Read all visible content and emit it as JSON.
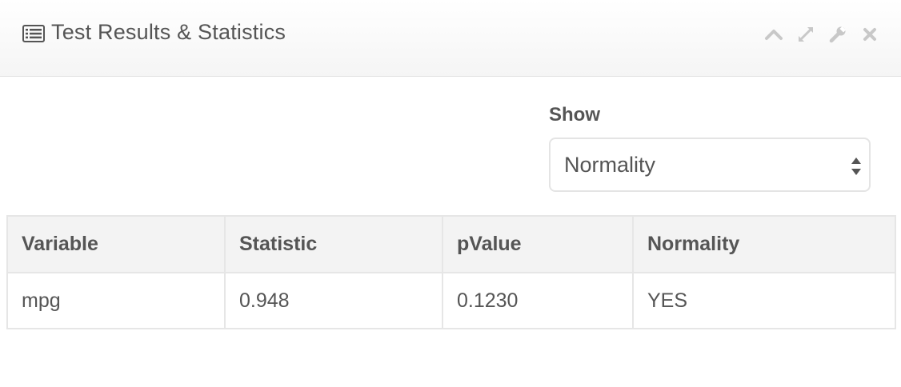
{
  "header": {
    "title": "Test Results & Statistics",
    "title_icon": "list-alt-icon",
    "tools": [
      {
        "name": "collapse-icon"
      },
      {
        "name": "fullscreen-icon"
      },
      {
        "name": "wrench-icon"
      },
      {
        "name": "close-icon"
      }
    ]
  },
  "filter": {
    "label": "Show",
    "selected": "Normality"
  },
  "table": {
    "columns": [
      "Variable",
      "Statistic",
      "pValue",
      "Normality"
    ],
    "rows": [
      [
        "mpg",
        "0.948",
        "0.1230",
        "YES"
      ]
    ]
  },
  "colors": {
    "text": "#555555",
    "header_bg": "#f3f3f3",
    "border": "#e6e6e6",
    "icon_muted": "#c8c8c8"
  }
}
